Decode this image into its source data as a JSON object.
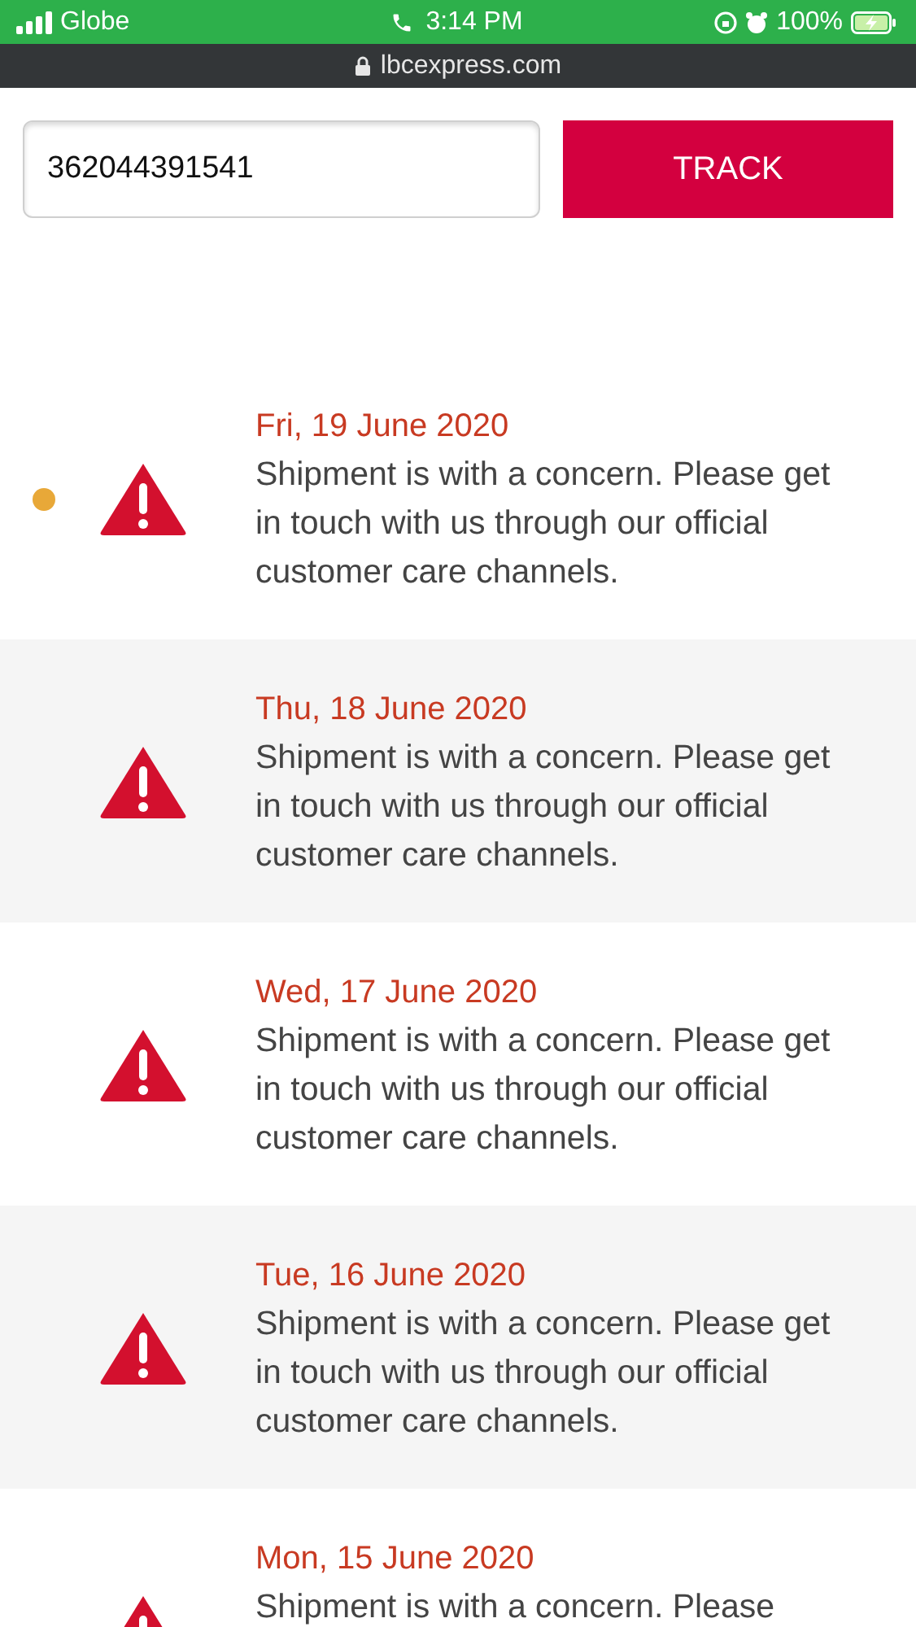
{
  "status_bar": {
    "carrier": "Globe",
    "time": "3:14 PM",
    "battery": "100%"
  },
  "address_bar": {
    "url": "lbcexpress.com"
  },
  "tracking": {
    "value": "362044391541",
    "button": "TRACK"
  },
  "events": [
    {
      "date": "Fri, 19 June 2020",
      "message": "Shipment is with a concern. Please get in touch with us through our official customer care channels.",
      "current": true
    },
    {
      "date": "Thu, 18 June 2020",
      "message": "Shipment is with a concern. Please get in touch with us through our official customer care channels.",
      "current": false
    },
    {
      "date": "Wed, 17 June 2020",
      "message": "Shipment is with a concern. Please get in touch with us through our official customer care channels.",
      "current": false
    },
    {
      "date": "Tue, 16 June 2020",
      "message": "Shipment is with a concern. Please get in touch with us through our official customer care channels.",
      "current": false
    },
    {
      "date": "Mon, 15 June 2020",
      "message": "Shipment is with a concern. Please",
      "current": false
    }
  ]
}
